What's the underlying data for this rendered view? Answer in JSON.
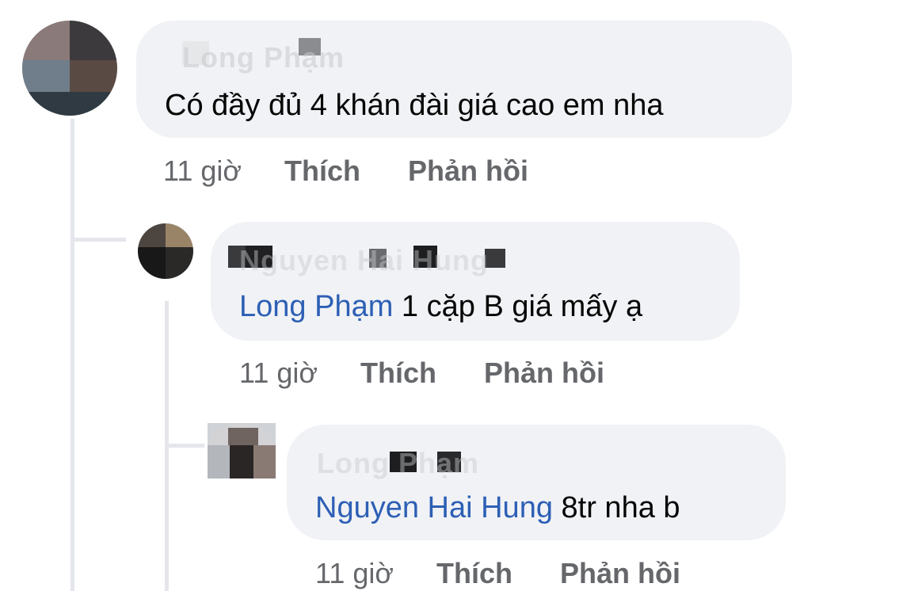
{
  "comments": [
    {
      "author": "Long Phạm",
      "mention": "",
      "text": "Có đầy đủ 4 khán đài giá cao em nha",
      "time": "11 giờ",
      "like": "Thích",
      "reply": "Phản hồi"
    },
    {
      "author": "Nguyen Hai Hung",
      "mention": "Long Phạm",
      "text": " 1 cặp B giá mấy ạ",
      "time": "11 giờ",
      "like": "Thích",
      "reply": "Phản hồi"
    },
    {
      "author": "Long Phạm",
      "mention": "Nguyen Hai Hung",
      "text": " 8tr nha b",
      "time": "11 giờ",
      "like": "Thích",
      "reply": "Phản hồi"
    }
  ],
  "colors": {
    "bubble": "#f0f2f5",
    "mention": "#2d5fb5",
    "meta": "#65676b",
    "thread_line": "#e4e6eb"
  }
}
